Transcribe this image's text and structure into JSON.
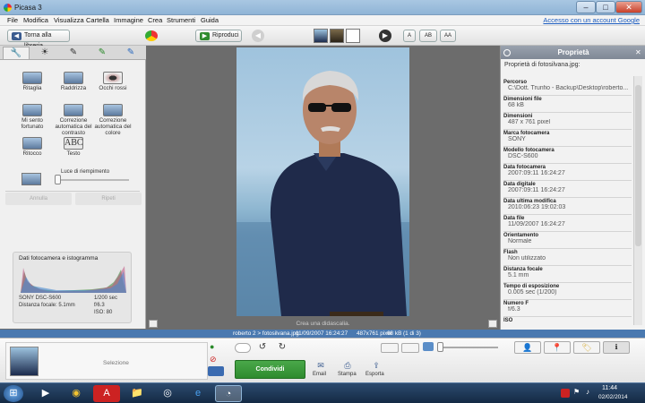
{
  "window": {
    "title": "Picasa 3",
    "min": "–",
    "max": "□",
    "close": "✕"
  },
  "menu": {
    "items": [
      "File",
      "Modifica",
      "Visualizza",
      "Cartella",
      "Immagine",
      "Crea",
      "Strumenti",
      "Guida"
    ],
    "account_link": "Accesso con un account Google"
  },
  "toolbar": {
    "back": "Torna alla libreria",
    "play": "Riproduci",
    "view_modes": [
      "A",
      "AB",
      "AA"
    ]
  },
  "tools": {
    "tabs": [
      "tools-icon",
      "sun-icon",
      "brush-icon",
      "brush-green-icon",
      "brush-blue-icon"
    ],
    "items": [
      {
        "label": "Ritaglia"
      },
      {
        "label": "Raddrizza"
      },
      {
        "label": "Occhi rossi"
      },
      {
        "label": "Mi sento fortunato"
      },
      {
        "label": "Correzione automatica del contrasto"
      },
      {
        "label": "Correzione automatica del colore"
      },
      {
        "label": "Ritocco"
      },
      {
        "label": "Testo"
      }
    ],
    "fill_light_label": "Luce di riempimento",
    "fill_light_value": 0,
    "undo": "Annulla",
    "redo": "Ripeti"
  },
  "histogram": {
    "title": "Dati fotocamera e istogramma",
    "camera": "SONY DSC-S600",
    "focal": "Distanza focale: 5.1mm",
    "shutter": "1/200 sec",
    "fstop": "f/6.3",
    "iso": "ISO: 80"
  },
  "viewer": {
    "caption_placeholder": "Crea una didascalia."
  },
  "properties": {
    "header": "Proprietà",
    "subtitle": "Proprietà di fotosilvana.jpg:",
    "rows": [
      {
        "label": "Percorso",
        "value": "C:\\Dott. Trunfio - Backup\\Desktop\\roberto..."
      },
      {
        "label": "Dimensioni file",
        "value": "68 kB"
      },
      {
        "label": "Dimensioni",
        "value": "487 x 761 pixel"
      },
      {
        "label": "Marca fotocamera",
        "value": "SONY"
      },
      {
        "label": "Modello fotocamera",
        "value": "DSC-S600"
      },
      {
        "label": "Data fotocamera",
        "value": "2007:09:11 16:24:27"
      },
      {
        "label": "Data digitale",
        "value": "2007:09:11 16:24:27"
      },
      {
        "label": "Data ultima modifica",
        "value": "2010:06:23 19:02:03"
      },
      {
        "label": "Data file",
        "value": "11/09/2007 16:24:27"
      },
      {
        "label": "Orientamento",
        "value": "Normale"
      },
      {
        "label": "Flash",
        "value": "Non utilizzato"
      },
      {
        "label": "Distanza focale",
        "value": "5.1 mm"
      },
      {
        "label": "Tempo di esposizione",
        "value": "0.005 sec (1/200)"
      },
      {
        "label": "Numero F",
        "value": "f/6.3"
      },
      {
        "label": "ISO",
        "value": ""
      }
    ]
  },
  "status": {
    "name": "roberto 2 > fotosilvana.jpg",
    "date": "11/09/2007 16:24:27",
    "dims": "487x761 pixel",
    "size": "68 kB",
    "count": "(1 di 3)"
  },
  "tray": {
    "selection_label": "Selezione",
    "share": "Condividi",
    "actions": [
      {
        "label": "Email",
        "icon": "email-icon"
      },
      {
        "label": "Stampa",
        "icon": "print-icon"
      },
      {
        "label": "Esporta",
        "icon": "export-icon"
      }
    ]
  },
  "taskbar": {
    "time": "11:44",
    "date": "02/02/2014"
  },
  "colors": {
    "accent_green": "#2e8b2e",
    "status_blue": "#4a79b0"
  }
}
